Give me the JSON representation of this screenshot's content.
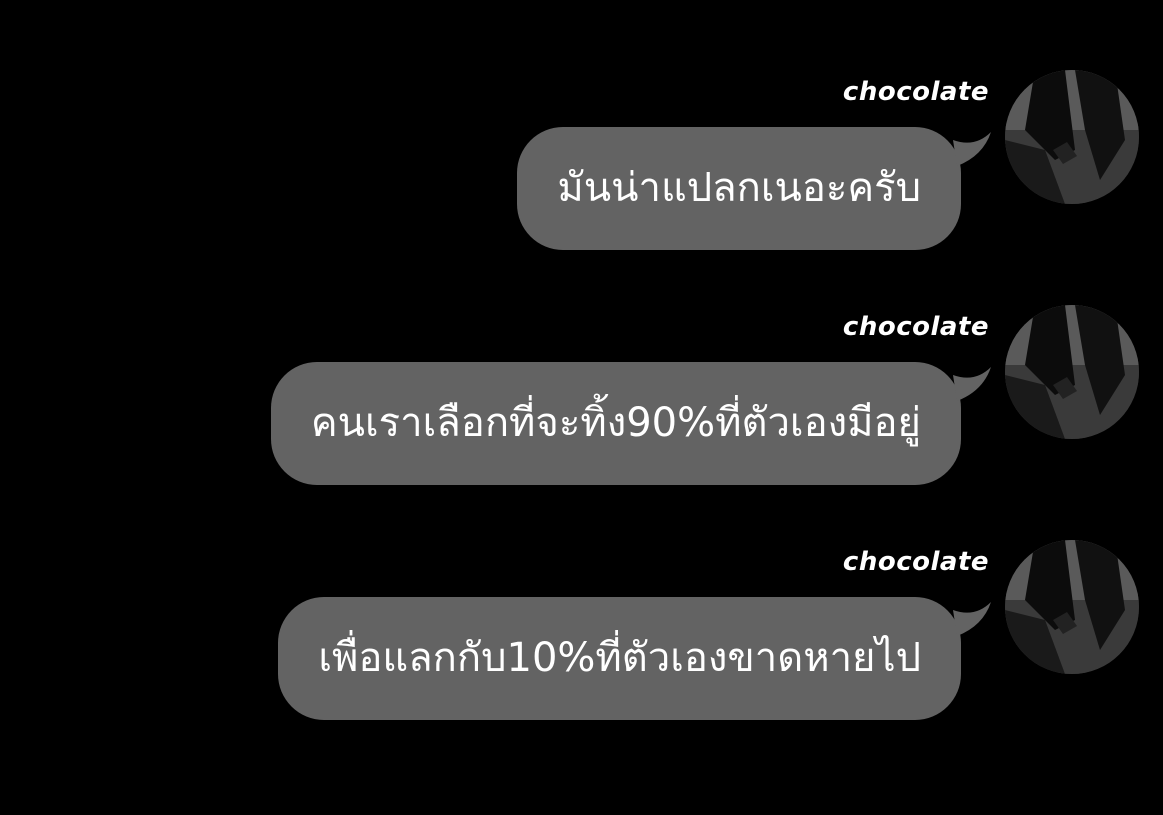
{
  "colors": {
    "background": "#000000",
    "bubble": "#636363",
    "text": "#ffffff"
  },
  "messages": [
    {
      "sender": "chocolate",
      "text": "มันน่าแปลกเนอะครับ",
      "avatar_icon": "avatar-photo-icon"
    },
    {
      "sender": "chocolate",
      "text": "คนเราเลือกที่จะทิ้ง90%ที่ตัวเองมีอยู่",
      "avatar_icon": "avatar-photo-icon"
    },
    {
      "sender": "chocolate",
      "text": "เพื่อแลกกับ10%ที่ตัวเองขาดหายไป",
      "avatar_icon": "avatar-photo-icon"
    }
  ]
}
